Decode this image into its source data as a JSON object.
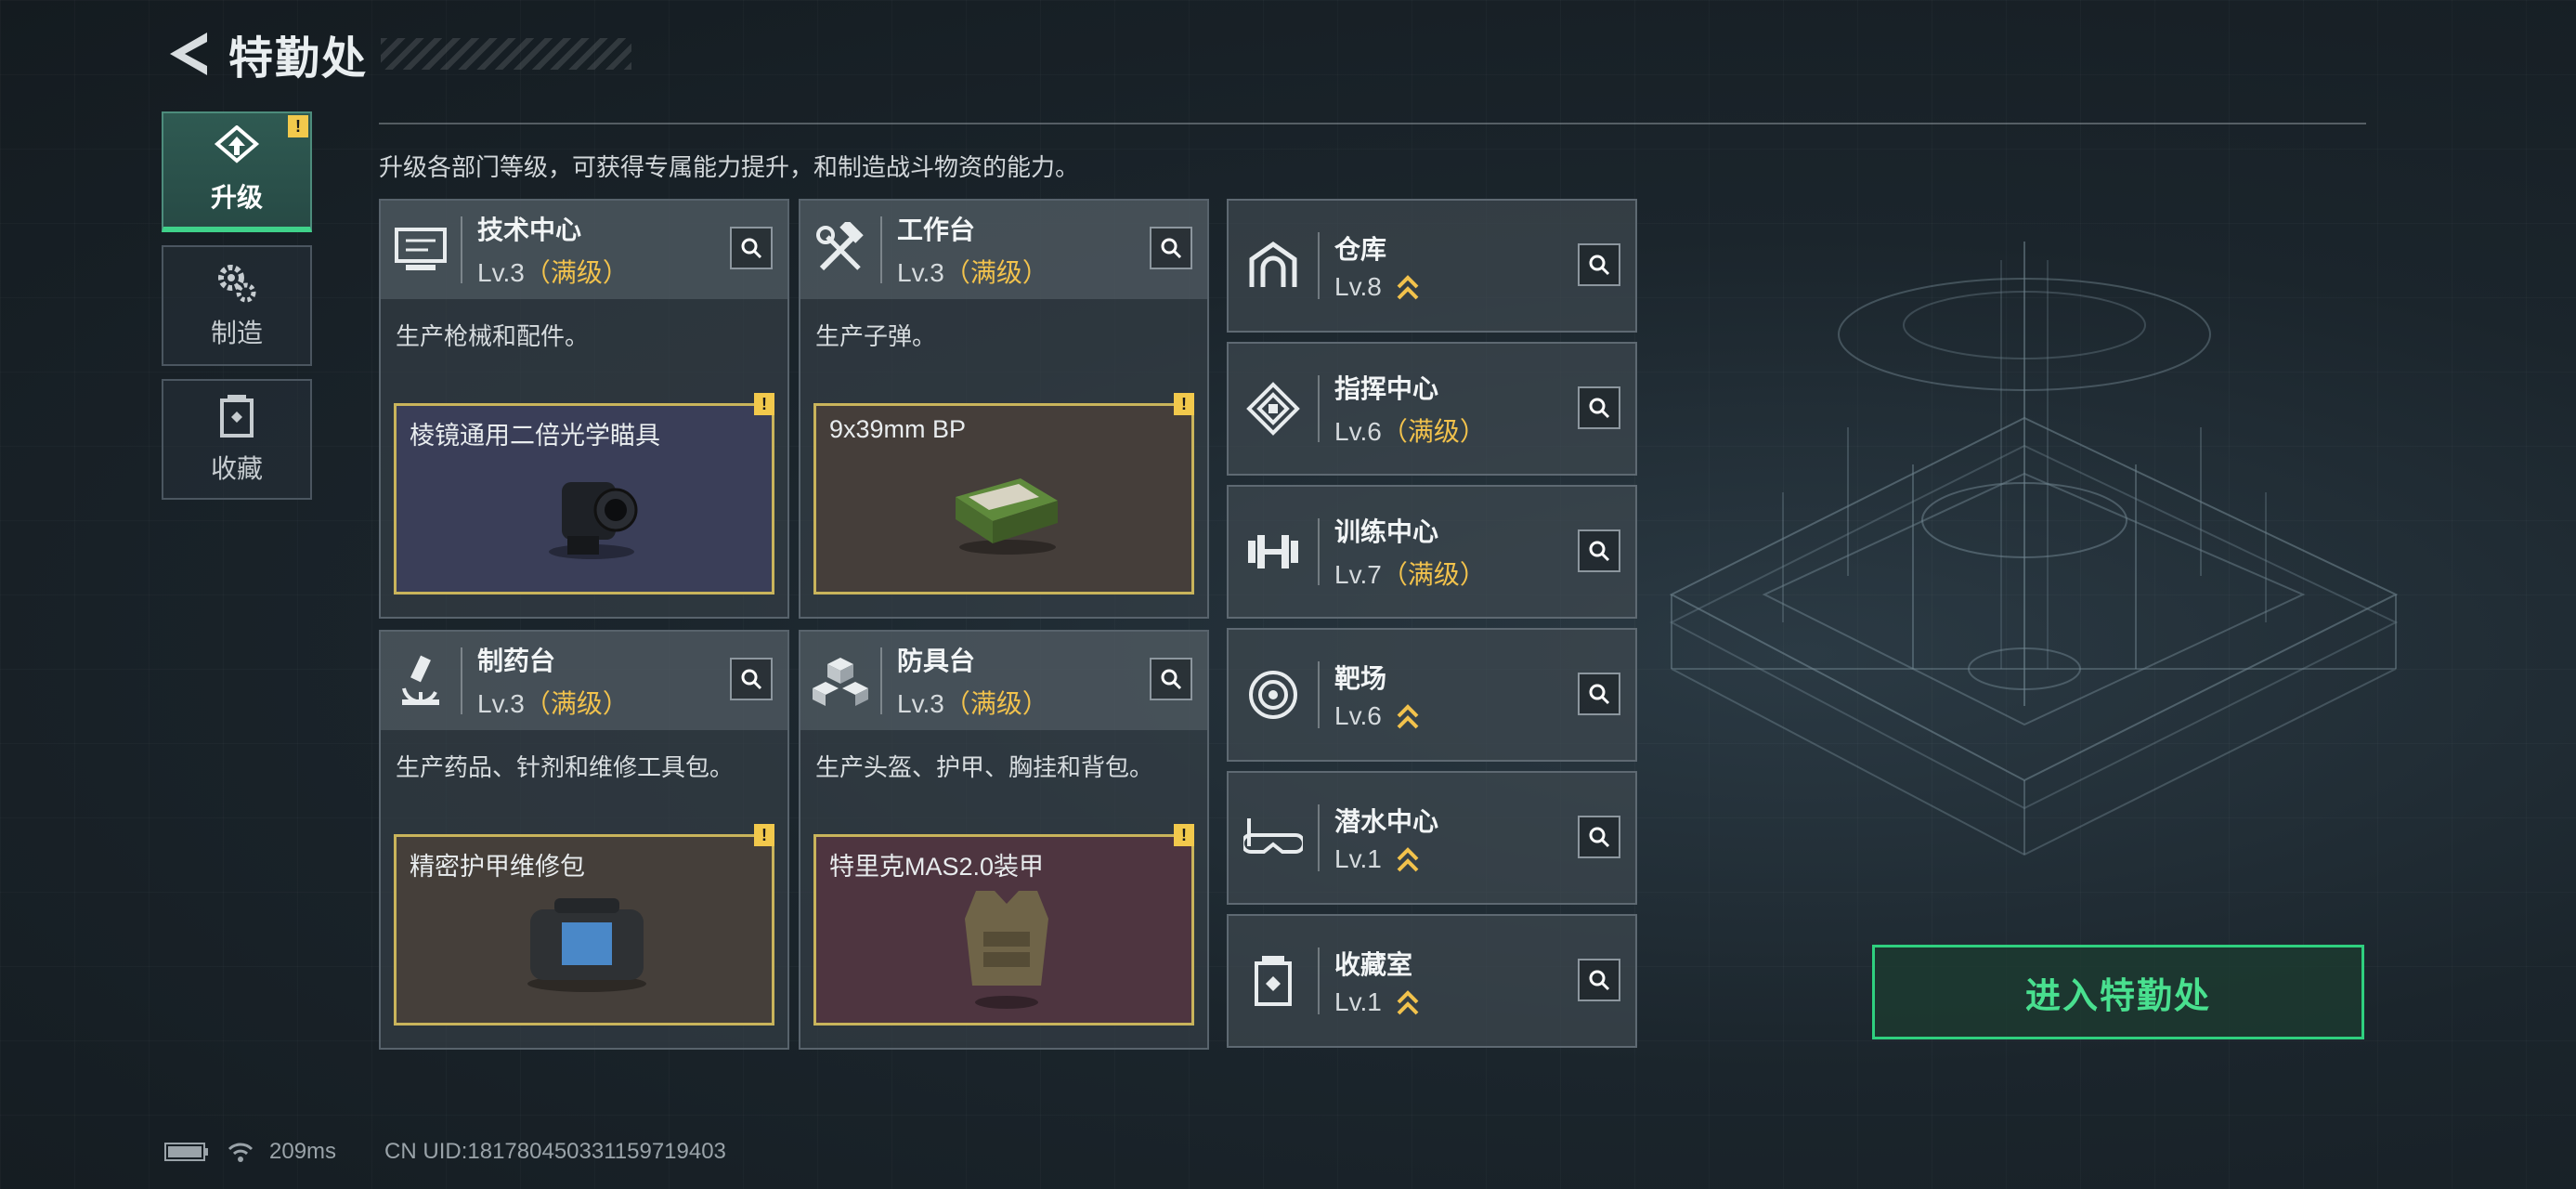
{
  "header": {
    "title": "特勤处"
  },
  "nav": {
    "items": [
      {
        "label": "升级",
        "icon": "upgrade-icon",
        "active": true,
        "warning": "!"
      },
      {
        "label": "制造",
        "icon": "gears-icon",
        "active": false
      },
      {
        "label": "收藏",
        "icon": "collection-icon",
        "active": false
      }
    ]
  },
  "description": "升级各部门等级，可获得专属能力提升，和制造战斗物资的能力。",
  "departments": [
    {
      "name": "技术中心",
      "level": "Lv.3",
      "maxed": "（满级）",
      "icon": "computer-icon",
      "desc": "生产枪械和配件。",
      "product": "棱镜通用二倍光学瞄具",
      "product_bg": "#3a3e58",
      "warning": "!"
    },
    {
      "name": "工作台",
      "level": "Lv.3",
      "maxed": "（满级）",
      "icon": "hammer-wrench-icon",
      "desc": "生产子弹。",
      "product": "9x39mm BP",
      "product_bg": "#453e3a",
      "warning": "!"
    },
    {
      "name": "制药台",
      "level": "Lv.3",
      "maxed": "（满级）",
      "icon": "microscope-icon",
      "desc": "生产药品、针剂和维修工具包。",
      "product": "精密护甲维修包",
      "product_bg": "#453f3a",
      "warning": "!"
    },
    {
      "name": "防具台",
      "level": "Lv.3",
      "maxed": "（满级）",
      "icon": "armor-cubes-icon",
      "desc": "生产头盔、护甲、胸挂和背包。",
      "product": "特里克MAS2.0装甲",
      "product_bg": "#4e3540",
      "warning": "!"
    }
  ],
  "facilities": [
    {
      "name": "仓库",
      "level": "Lv.8",
      "maxed": "",
      "icon": "warehouse-icon",
      "upgradable": true
    },
    {
      "name": "指挥中心",
      "level": "Lv.6",
      "maxed": "（满级）",
      "icon": "command-icon",
      "upgradable": false
    },
    {
      "name": "训练中心",
      "level": "Lv.7",
      "maxed": "（满级）",
      "icon": "dumbbell-icon",
      "upgradable": false
    },
    {
      "name": "靶场",
      "level": "Lv.6",
      "maxed": "",
      "icon": "target-icon",
      "upgradable": true
    },
    {
      "name": "潜水中心",
      "level": "Lv.1",
      "maxed": "",
      "icon": "diving-mask-icon",
      "upgradable": true
    },
    {
      "name": "收藏室",
      "level": "Lv.1",
      "maxed": "",
      "icon": "collection-room-icon",
      "upgradable": true
    }
  ],
  "enter_button": {
    "label": "进入特勤处"
  },
  "status": {
    "ping": "209ms",
    "uid": "CN UID:181780450331159719403"
  },
  "colors": {
    "accent": "#3fd28a",
    "maxed": "#f2c24c",
    "warning": "#f2c94c"
  }
}
